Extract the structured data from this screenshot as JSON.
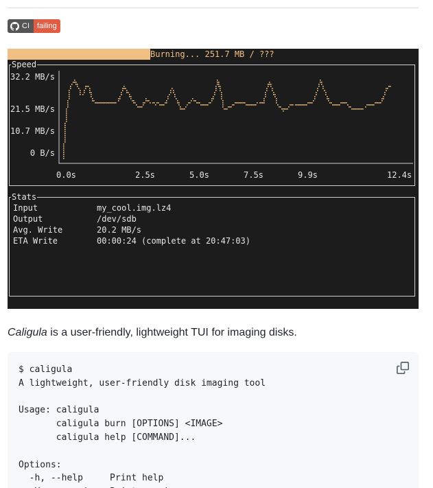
{
  "badge": {
    "left_label": "CI",
    "right_label": "failing",
    "left_color": "#555555",
    "right_color": "#e05d44"
  },
  "terminal": {
    "progress_text": "Burning... 251.7 MB / ???",
    "progress_color": "#f2bf82",
    "speed_title": "Speed",
    "stats_title": "Stats",
    "stats": [
      {
        "label": "Input",
        "value": "my_cool.img.lz4"
      },
      {
        "label": "Output",
        "value": "/dev/sdb"
      },
      {
        "label": "Avg. Write",
        "value": "20.2 MB/s"
      },
      {
        "label": "ETA Write",
        "value": "00:00:24 (complete at 20:47:03)"
      }
    ]
  },
  "chart_data": {
    "type": "line",
    "ytick_labels": [
      "32.2 MB/s",
      "21.5 MB/s",
      "10.7 MB/s",
      "0 B/s"
    ],
    "xtick_labels": [
      "0.0s",
      "2.5s",
      "5.0s",
      "7.5s",
      "9.9s",
      "12.4s"
    ],
    "xlim": [
      0,
      12.4
    ],
    "ylim": [
      0,
      32.2
    ],
    "series_color": "#f2bf82",
    "x": [
      0,
      0.02,
      0.05,
      0.1,
      0.15,
      0.2,
      0.25,
      0.3,
      0.4,
      0.5,
      0.55,
      0.6,
      0.7,
      0.75,
      0.8,
      0.9,
      1.0,
      1.1,
      1.2,
      1.3,
      1.4,
      1.5,
      1.6,
      1.7,
      1.8,
      1.9,
      2.0,
      2.1,
      2.2,
      2.3,
      2.4,
      2.5,
      2.6,
      2.7,
      2.8,
      2.9,
      3.0,
      3.1,
      3.2,
      3.3,
      3.4,
      3.5,
      3.6,
      3.7,
      3.8,
      3.9,
      4.0,
      4.1,
      4.2,
      4.3,
      4.4,
      4.5,
      4.6,
      4.7,
      4.8,
      4.9,
      5.0,
      5.1,
      5.2,
      5.3,
      5.4,
      5.5,
      5.6,
      5.7,
      5.8,
      5.9,
      6.0,
      6.1,
      6.2,
      6.3,
      6.4,
      6.5,
      6.6,
      6.7,
      6.8,
      6.9,
      7.0,
      7.1,
      7.2,
      7.3,
      7.4,
      7.5,
      7.6,
      7.7,
      7.8,
      7.9,
      8.0,
      8.1,
      8.2,
      8.3,
      8.4,
      8.5,
      8.6,
      8.7,
      8.8,
      8.9,
      9.0,
      9.1,
      9.2,
      9.3,
      9.4,
      9.5,
      9.6,
      9.7,
      9.8,
      9.9,
      10.0,
      10.1,
      10.2,
      10.3,
      10.4,
      10.5,
      10.6,
      10.7,
      10.8,
      10.9,
      11.0,
      11.1,
      11.2,
      11.3,
      11.4,
      11.5,
      11.6,
      11.7,
      11.8,
      11.9,
      12.0,
      12.1,
      12.2,
      12.3,
      12.4
    ],
    "y": [
      0,
      5,
      12,
      18,
      21.5,
      26,
      29,
      29.5,
      31,
      28.5,
      27.5,
      25.5,
      26,
      27.5,
      29,
      28,
      23,
      22.5,
      22,
      21.8,
      22,
      22.3,
      22.2,
      22.3,
      22.2,
      22.8,
      25,
      28.5,
      27,
      25.5,
      23,
      21.8,
      20.5,
      20.3,
      21.8,
      23.5,
      23,
      22,
      21.6,
      21.8,
      21.5,
      21.5,
      22.5,
      25.5,
      27.5,
      24.5,
      22.5,
      19.5,
      19.4,
      20.5,
      22.5,
      23.5,
      23,
      21.8,
      21.6,
      21.5,
      21.5,
      21.8,
      23.5,
      26,
      31,
      27,
      20,
      19.8,
      20.5,
      21,
      22,
      22.5,
      22,
      21.8,
      21.6,
      21.5,
      21.3,
      21.5,
      21.8,
      22,
      22.5,
      27,
      30.5,
      28,
      25,
      21,
      20.2,
      19,
      19.6,
      20.5,
      21.5,
      21.6,
      21.5,
      21,
      21,
      21.5,
      22,
      22.5,
      23.5,
      28,
      31,
      28,
      25.5,
      22,
      21.5,
      21.3,
      21.5,
      21.8,
      22,
      21.8,
      20.5,
      20,
      19.8,
      19.5,
      19.8,
      20,
      21,
      21.5,
      21.5,
      21.8,
      22,
      22.5,
      24,
      27.5,
      29,
      28
    ]
  },
  "description": {
    "app_name": "Caligula",
    "rest": " is a user-friendly, lightweight TUI for imaging disks."
  },
  "code_block": {
    "text": "$ caligula\nA lightweight, user-friendly disk imaging tool\n\nUsage: caligula\n       caligula burn [OPTIONS] <IMAGE>\n       caligula help [COMMAND]...\n\nOptions:\n  -h, --help     Print help\n  -V, --version  Print version"
  }
}
